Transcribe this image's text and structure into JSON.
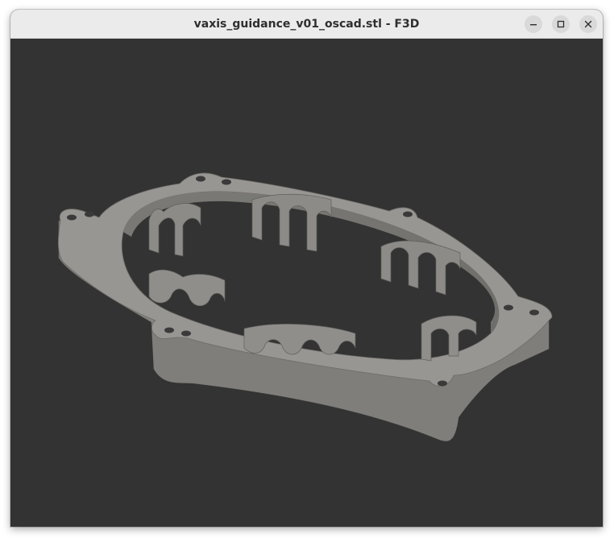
{
  "window": {
    "title": "vaxis_guidance_v01_oscad.stl - F3D",
    "buttons": {
      "minimize_icon": "minimize-icon",
      "maximize_icon": "maximize-icon",
      "close_icon": "close-icon"
    }
  },
  "viewport": {
    "background_color": "#333333",
    "model_color": "#8f8e8a",
    "model_description_icon": "3d-model-render"
  }
}
